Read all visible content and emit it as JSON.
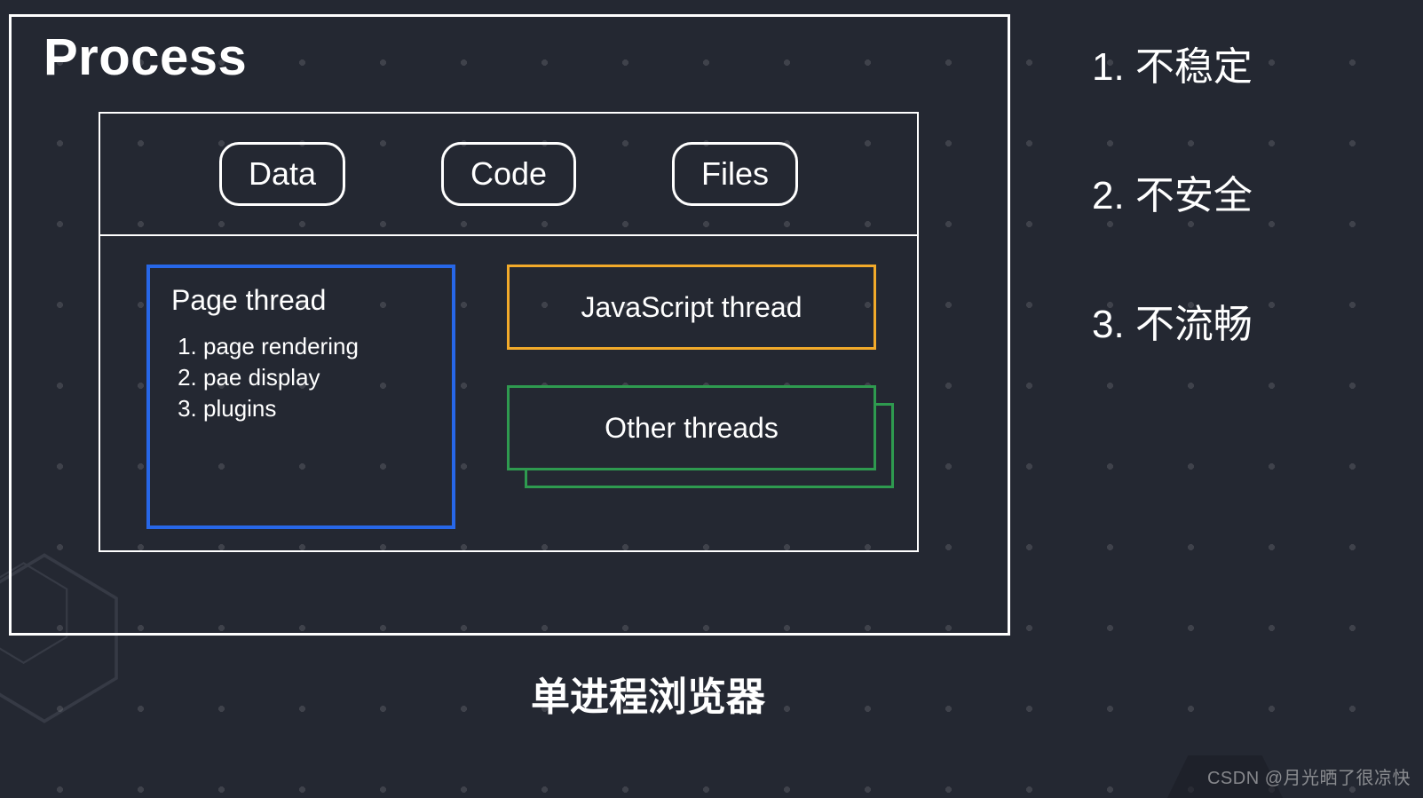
{
  "process": {
    "title": "Process",
    "resources": {
      "data": "Data",
      "code": "Code",
      "files": "Files"
    },
    "page_thread": {
      "title": "Page thread",
      "items": [
        "page rendering",
        "pae display",
        "plugins"
      ]
    },
    "js_thread": {
      "title": "JavaScript thread"
    },
    "other_threads": {
      "title": "Other threads"
    }
  },
  "side_points": {
    "p1": "1. 不稳定",
    "p2": "2. 不安全",
    "p3": "3. 不流畅"
  },
  "caption": "单进程浏览器",
  "watermark": "CSDN @月光晒了很凉快"
}
